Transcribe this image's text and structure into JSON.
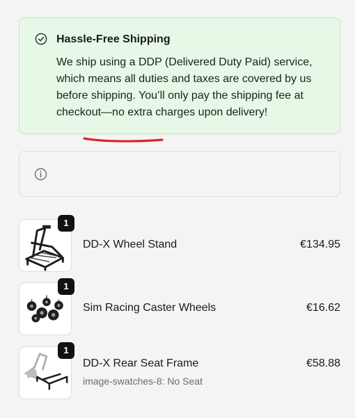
{
  "shipping_notice": {
    "icon": "check-circle-icon",
    "title": "Hassle-Free Shipping",
    "lines": [
      "We ship using a DDP (Delivered Duty Paid) service,",
      "which means all duties and taxes are covered by us",
      "before shipping. You’ll only pay the shipping fee at",
      "checkout—no extra charges upon delivery!"
    ],
    "accent_color": "#e7f9e6"
  },
  "info_box": {
    "icon": "info-icon"
  },
  "cart": {
    "items": [
      {
        "name": "DD-X Wheel Stand",
        "quantity": "1",
        "price": "€134.95",
        "image_icon": "wheel-stand-image"
      },
      {
        "name": "Sim Racing Caster Wheels",
        "quantity": "1",
        "price": "€16.62",
        "image_icon": "caster-wheels-image"
      },
      {
        "name": "DD-X Rear Seat Frame",
        "variant": "image-swatches-8: No Seat",
        "quantity": "1",
        "price": "€58.88",
        "image_icon": "seat-frame-image"
      }
    ]
  }
}
